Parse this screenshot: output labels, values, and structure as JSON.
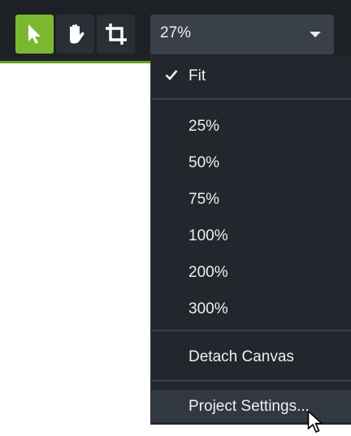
{
  "toolbar": {
    "tools": [
      {
        "icon": "arrow-pointer-icon",
        "active": true
      },
      {
        "icon": "hand-pan-icon",
        "active": false
      },
      {
        "icon": "crop-icon",
        "active": false
      }
    ],
    "zoom_select": {
      "value": "27%",
      "icon": "caret-down-icon"
    }
  },
  "zoom_menu": {
    "fit_label": "Fit",
    "fit_checked": true,
    "levels": [
      "25%",
      "50%",
      "75%",
      "100%",
      "200%",
      "300%"
    ],
    "detach_label": "Detach Canvas",
    "project_settings_label": "Project Settings..."
  },
  "colors": {
    "toolbar_bg": "#1d2126",
    "active_tool": "#7cb82f",
    "menu_bg": "#22272d",
    "menu_hover": "#323842",
    "text": "#eef0f2"
  }
}
